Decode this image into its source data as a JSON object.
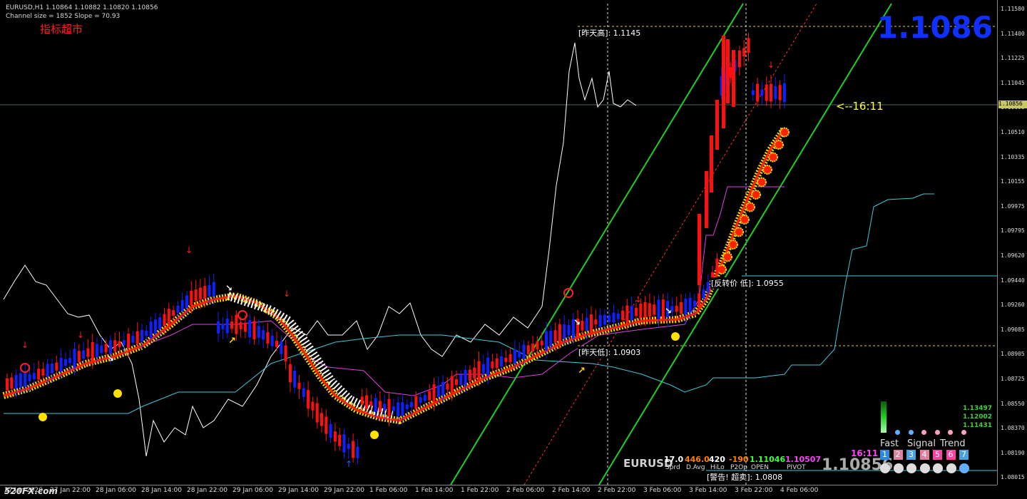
{
  "header": {
    "symbol_line": "EURUSD,H1  1.10864 1.10882 1.10820 1.10856",
    "channel_line": "Channel size = 1852  Slope = 70.93",
    "title_cn": "指标超市"
  },
  "big_price": "1.1086",
  "labels": {
    "yesterday_high": "[昨天高]: 1.1145",
    "yesterday_low": "[昨天低]: 1.0903",
    "reversal_low": "[反转价 低]: 1.0955",
    "warning_sell": "[警告! 超卖]: 1.0808",
    "timer": "<--16:11"
  },
  "y_axis": {
    "ticks": [
      "1.11580",
      "1.11400",
      "1.11225",
      "1.11045",
      "1.10690",
      "1.10510",
      "1.10335",
      "1.10155",
      "1.09975",
      "1.09795",
      "1.09620",
      "1.09440",
      "1.09260",
      "1.09085",
      "1.08905",
      "1.08725",
      "1.08550",
      "1.08370",
      "1.08190",
      "1.08015"
    ],
    "current": "1.10856"
  },
  "x_axis": {
    "ticks": [
      "27 Jan 2020",
      "27 Jan 22:00",
      "28 Jan 06:00",
      "28 Jan 14:00",
      "28 Jan 22:00",
      "29 Jan 06:00",
      "29 Jan 14:00",
      "29 Jan 22:00",
      "1 Feb 06:00",
      "1 Feb 14:00",
      "1 Feb 22:00",
      "2 Feb 06:00",
      "2 Feb 14:00",
      "2 Feb 22:00",
      "3 Feb 06:00",
      "3 Feb 14:00",
      "3 Feb 22:00",
      "4 Feb 06:00"
    ]
  },
  "logo": "520FX.com",
  "panel": {
    "symbol": "EURUSD",
    "stats": [
      {
        "value": "17.0",
        "label": "Sprd",
        "color": "#ffffff"
      },
      {
        "value": "446.0",
        "label": "D.Avg",
        "color": "#ff8000"
      },
      {
        "value": "420",
        "label": "HiLo",
        "color": "#ffffff"
      },
      {
        "value": "-190",
        "label": "P2Op",
        "color": "#ff8000"
      },
      {
        "value": "1.11046",
        "label": "OPEN",
        "color": "#40ff40"
      },
      {
        "value": "1.10507",
        "label": "PIVOT",
        "color": "#ff40ff"
      }
    ],
    "price": "1.10856",
    "time": "16:11",
    "signal_headers": [
      "Fast",
      "Signal",
      "Trend"
    ],
    "levels": [
      "1.13497",
      "1.12002",
      "1.11431"
    ],
    "numbers": [
      "1",
      "2",
      "3",
      "4",
      "5",
      "6",
      "7"
    ],
    "colors": {
      "up": "#ff1010",
      "down": "#1020ff",
      "wick": "#ff1010",
      "white_line": "#ffffff",
      "cyan_line": "#40c8d8",
      "magenta_line": "#e040e0",
      "channel": "#20d020"
    }
  }
}
